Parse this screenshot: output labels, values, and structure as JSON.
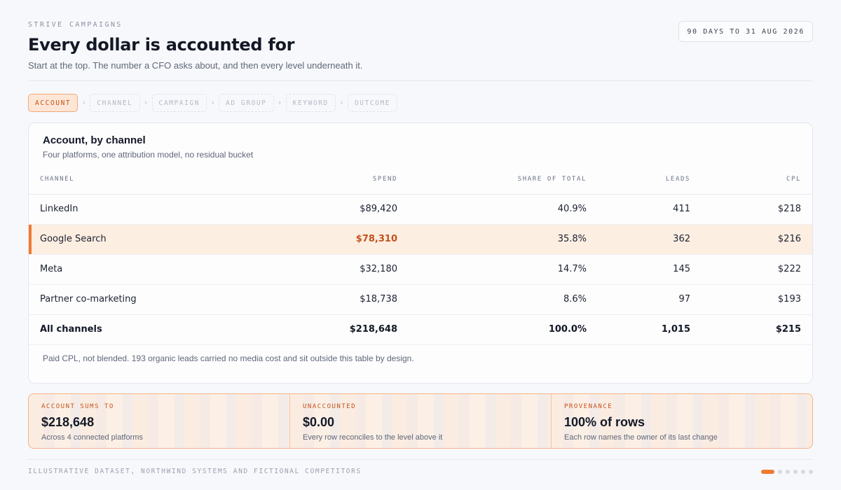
{
  "header": {
    "eyebrow": "STRIVE CAMPAIGNS",
    "title": "Every dollar is accounted for",
    "subtitle": "Start at the top. The number a CFO asks about, and then every level underneath it.",
    "range": "90 DAYS TO 31 AUG 2026"
  },
  "breadcrumbs": {
    "account": "ACCOUNT",
    "channel": "CHANNEL",
    "campaign": "CAMPAIGN",
    "ad_group": "AD GROUP",
    "keyword": "KEYWORD",
    "outcome": "OUTCOME",
    "separator": "›",
    "active": "account"
  },
  "card": {
    "title": "Account, by channel",
    "subtitle": "Four platforms, one attribution model, no residual bucket",
    "columns": {
      "channel": "CHANNEL",
      "spend": "SPEND",
      "share": "SHARE OF TOTAL",
      "leads": "LEADS",
      "cpl": "CPL"
    },
    "rows": [
      {
        "channel": "LinkedIn",
        "spend": "$89,420",
        "share": "40.9%",
        "leads": "411",
        "cpl": "$218"
      },
      {
        "channel": "Google Search",
        "spend": "$78,310",
        "share": "35.8%",
        "leads": "362",
        "cpl": "$216"
      },
      {
        "channel": "Meta",
        "spend": "$32,180",
        "share": "14.7%",
        "leads": "145",
        "cpl": "$222"
      },
      {
        "channel": "Partner co-marketing",
        "spend": "$18,738",
        "share": "8.6%",
        "leads": "97",
        "cpl": "$193"
      }
    ],
    "total": {
      "channel": "All channels",
      "spend": "$218,648",
      "share": "100.0%",
      "leads": "1,015",
      "cpl": "$215"
    },
    "footnote": "Paid CPL, not blended. 193 organic leads carried no media cost and sit outside this table by design."
  },
  "stats": [
    {
      "label": "ACCOUNT SUMS TO",
      "value": "$218,648",
      "note": "Across 4 connected platforms"
    },
    {
      "label": "UNACCOUNTED",
      "value": "$0.00",
      "note": "Every row reconciles to the level above it"
    },
    {
      "label": "PROVENANCE",
      "value": "100% of rows",
      "note": "Each row names the owner of its last change"
    }
  ],
  "footer": {
    "text": "ILLUSTRATIVE DATASET, NORTHWIND SYSTEMS AND FICTIONAL COMPETITORS",
    "slide_count": 6,
    "active_slide": 1
  },
  "colors": {
    "accent": "#f07a30",
    "accent_text": "#c4521c",
    "highlight_row": "#fdeee2"
  }
}
